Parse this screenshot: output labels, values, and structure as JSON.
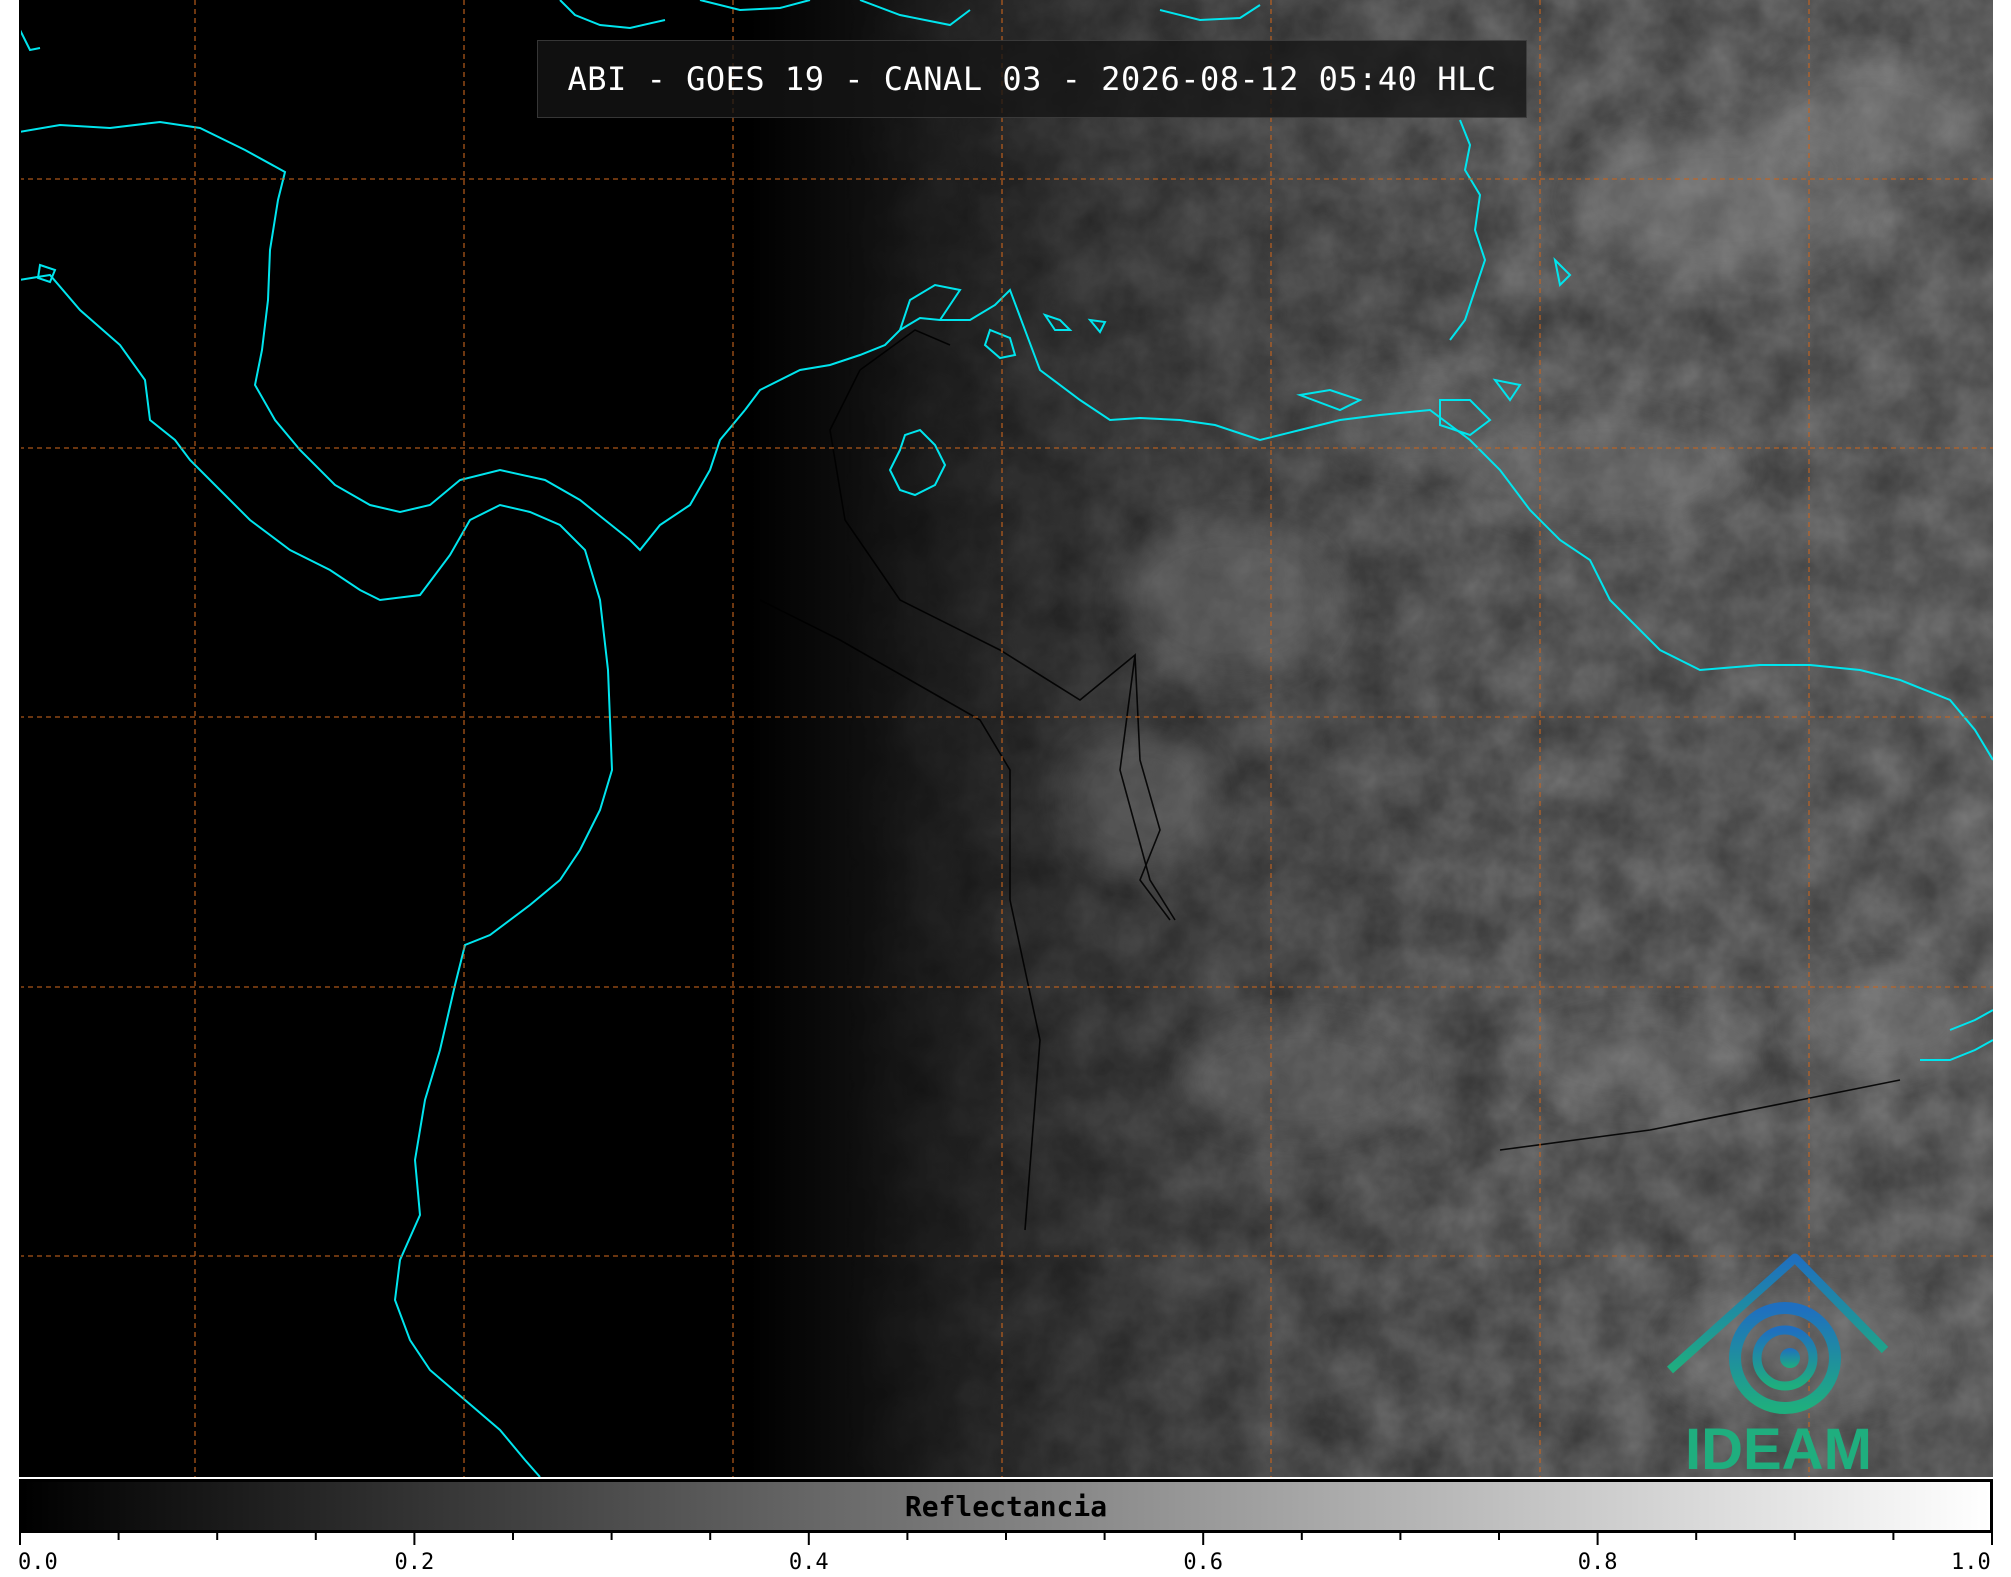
{
  "map": {
    "title": "ABI - GOES 19 - CANAL 03 - 2026-08-12 05:40 HLC",
    "coastline_color": "#00e5ee",
    "grid_color": "#c8641e",
    "border_color": "#000000"
  },
  "logo": {
    "text": "IDEAM",
    "colors": [
      "#1f6fc0",
      "#1fae7e"
    ],
    "icon": "ideam-mountain-swirl-logo"
  },
  "colorbar": {
    "label": "Reflectancia",
    "range": [
      0.0,
      1.0
    ],
    "gradient": [
      "#000000",
      "#ffffff"
    ],
    "ticks": [
      {
        "value": 0.0,
        "label": "0.0"
      },
      {
        "value": 0.2,
        "label": "0.2"
      },
      {
        "value": 0.4,
        "label": "0.4"
      },
      {
        "value": 0.6,
        "label": "0.6"
      },
      {
        "value": 0.8,
        "label": "0.8"
      },
      {
        "value": 1.0,
        "label": "1.0"
      }
    ],
    "minor_step": 0.05
  }
}
